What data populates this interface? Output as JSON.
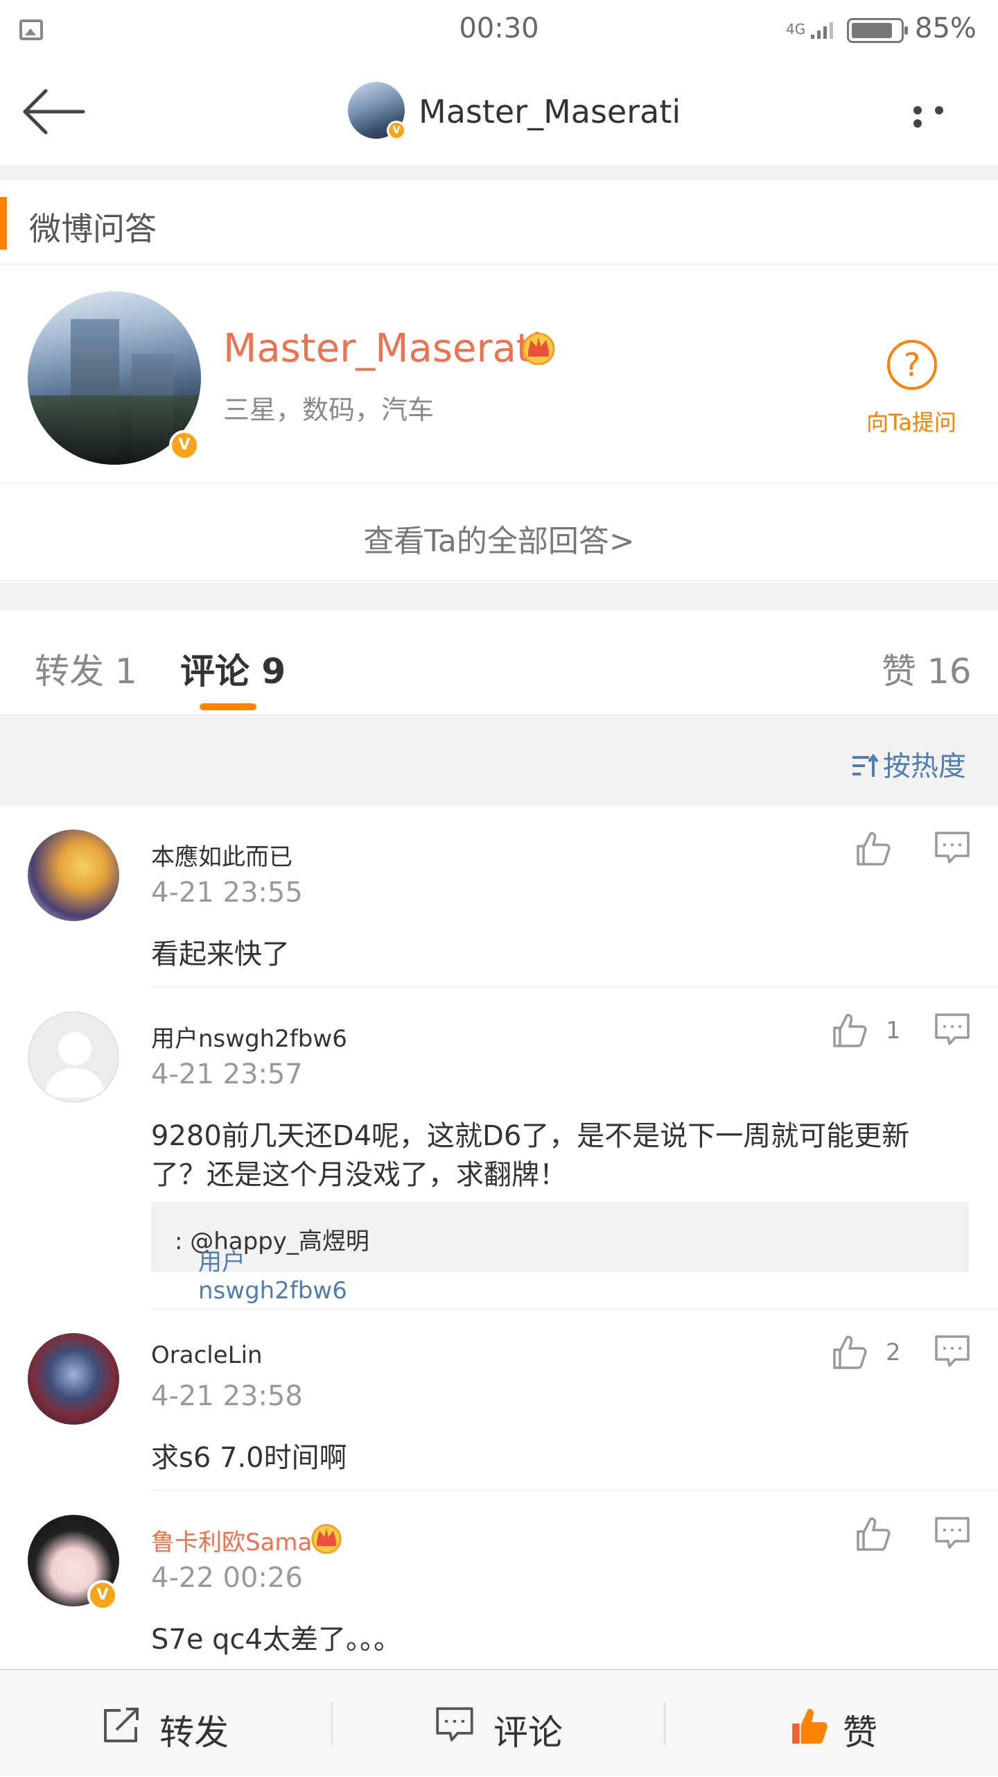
{
  "status_bar": {
    "time": "00:30",
    "network": "4G",
    "battery_pct": "85%",
    "battery_level": 0.85
  },
  "nav": {
    "title": "Master_Maserati"
  },
  "qa": {
    "section_title": "微博问答",
    "name": "Master_Maserati",
    "tags": "三星，数码，汽车",
    "ask_label": "向Ta提问",
    "all_answers_link": "查看Ta的全部回答>",
    "verified_mark": "V"
  },
  "tabs": [
    {
      "label": "转发 1"
    },
    {
      "label": "评论 9"
    },
    {
      "label": "赞 16"
    }
  ],
  "sort": {
    "label": "按热度"
  },
  "comments": [
    {
      "name": "本應如此而已",
      "time": "4-21 23:55",
      "text": "看起来快了",
      "likes": ""
    },
    {
      "name": "用户nswgh2fbw6",
      "time": "4-21 23:57",
      "text": "9280前几天还D4呢，这就D6了，是不是说下一周就可能更新了？还是这个月没戏了，求翻牌！",
      "likes": "1",
      "quote_user": "用户nswgh2fbw6",
      "quote_text": ": @happy_高煜明"
    },
    {
      "name": "OracleLin",
      "time": "4-21 23:58",
      "text": "求s6 7.0时间啊",
      "likes": "2"
    },
    {
      "name": "鲁卡利欧Sama",
      "time": "4-22 00:26",
      "text": "S7e qc4太差了。。。",
      "likes": ""
    }
  ],
  "bottom": {
    "repost": "转发",
    "comment": "评论",
    "like": "赞"
  },
  "colors": {
    "accent": "#ff8200",
    "name_orange": "#eb7350",
    "link_blue": "#507daf"
  }
}
